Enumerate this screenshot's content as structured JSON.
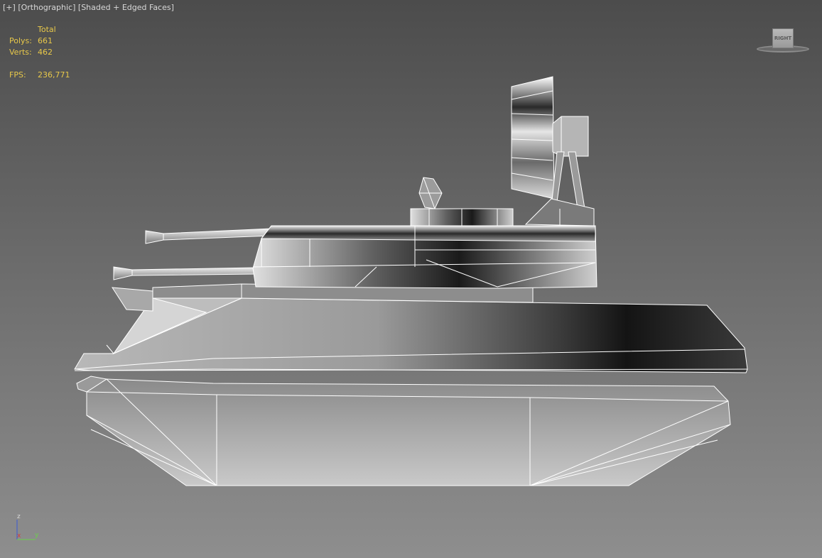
{
  "viewport": {
    "plus_menu": "[+]",
    "view_menu": "[Orthographic]",
    "shading_menu": "[Shaded + Edged Faces]"
  },
  "stats": {
    "header": "Total",
    "polys_label": "Polys:",
    "polys_value": "661",
    "verts_label": "Verts:",
    "verts_value": "462",
    "fps_label": "FPS:",
    "fps_value": "236,771"
  },
  "viewcube": {
    "label": "RIGHT"
  },
  "axis": {
    "z": "z",
    "x": "x",
    "y": "y"
  },
  "colors": {
    "stats_text": "#e8c84a",
    "edge": "#ffffff",
    "axis_x": "#d43a3a",
    "axis_y": "#6bd14a",
    "axis_z": "#3a5ad4"
  }
}
